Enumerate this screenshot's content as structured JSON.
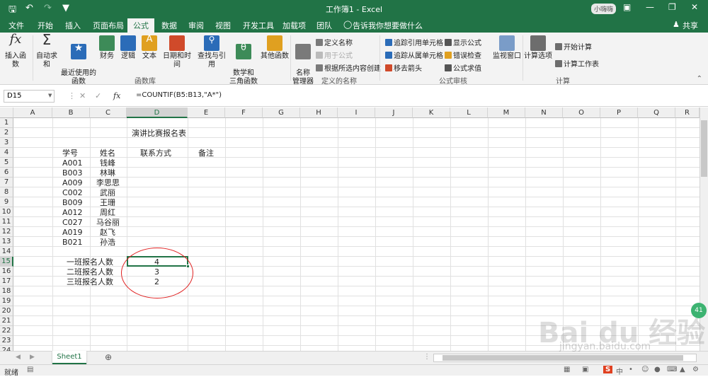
{
  "titlebar": {
    "title": "工作簿1  -  Excel",
    "user_badge": "小嗨嗨"
  },
  "tabs": [
    "文件",
    "开始",
    "插入",
    "页面布局",
    "公式",
    "数据",
    "审阅",
    "视图",
    "开发工具",
    "加载项",
    "团队"
  ],
  "tell_me": "告诉我你想要做什么",
  "share": "共享",
  "ribbon": {
    "insert_fn": "插入函数",
    "autosum": "自动求和",
    "recent": "最近使用的\n函数",
    "finance": "财务",
    "logic": "逻辑",
    "text": "文本",
    "datetime": "日期和时间",
    "lookup": "查找与引用",
    "math": "数学和\n三角函数",
    "other": "其他函数",
    "group_lib": "函数库",
    "name_mgr": "名称\n管理器",
    "define_name": "定义名称",
    "use_in_formula": "用于公式",
    "create_sel": "根据所选内容创建",
    "group_names": "定义的名称",
    "trace_prec": "追踪引用单元格",
    "trace_dep": "追踪从属单元格",
    "remove_arrows": "移去箭头",
    "show_formulas": "显示公式",
    "error_check": "错误检查",
    "eval_formula": "公式求值",
    "group_audit": "公式审核",
    "watch": "监视窗口",
    "calc_opts": "计算选项",
    "calc_now": "开始计算",
    "calc_sheet": "计算工作表",
    "group_calc": "计算"
  },
  "formula_bar": {
    "name_box": "D15",
    "formula": "=COUNTIF(B5:B13,\"A*\")"
  },
  "columns": [
    "A",
    "B",
    "C",
    "D",
    "E",
    "F",
    "G",
    "H",
    "I",
    "J",
    "K",
    "L",
    "M",
    "N",
    "O",
    "P",
    "Q",
    "R"
  ],
  "rows": [
    "1",
    "2",
    "3",
    "4",
    "5",
    "6",
    "7",
    "8",
    "9",
    "10",
    "11",
    "12",
    "13",
    "14",
    "15",
    "16",
    "17",
    "18",
    "19",
    "20",
    "21",
    "22",
    "23",
    "24"
  ],
  "cells": {
    "title": "演讲比赛报名表",
    "h_id": "学号",
    "h_name": "姓名",
    "h_contact": "联系方式",
    "h_note": "备注",
    "ids": [
      "A001",
      "B003",
      "A009",
      "C002",
      "B009",
      "A012",
      "C027",
      "A019",
      "B021"
    ],
    "names": [
      "钱峰",
      "林琳",
      "李思思",
      "武丽",
      "王珊",
      "周红",
      "马谷丽",
      "赵飞",
      "孙浩"
    ],
    "labels": [
      "一班报名人数",
      "二班报名人数",
      "三班报名人数"
    ],
    "counts": [
      "4",
      "3",
      "2"
    ]
  },
  "sheet_tab": "Sheet1",
  "status": "就绪",
  "watermark": "Bai du 经验",
  "watermark_url": "jingyan.baidu.com",
  "badge": "41"
}
